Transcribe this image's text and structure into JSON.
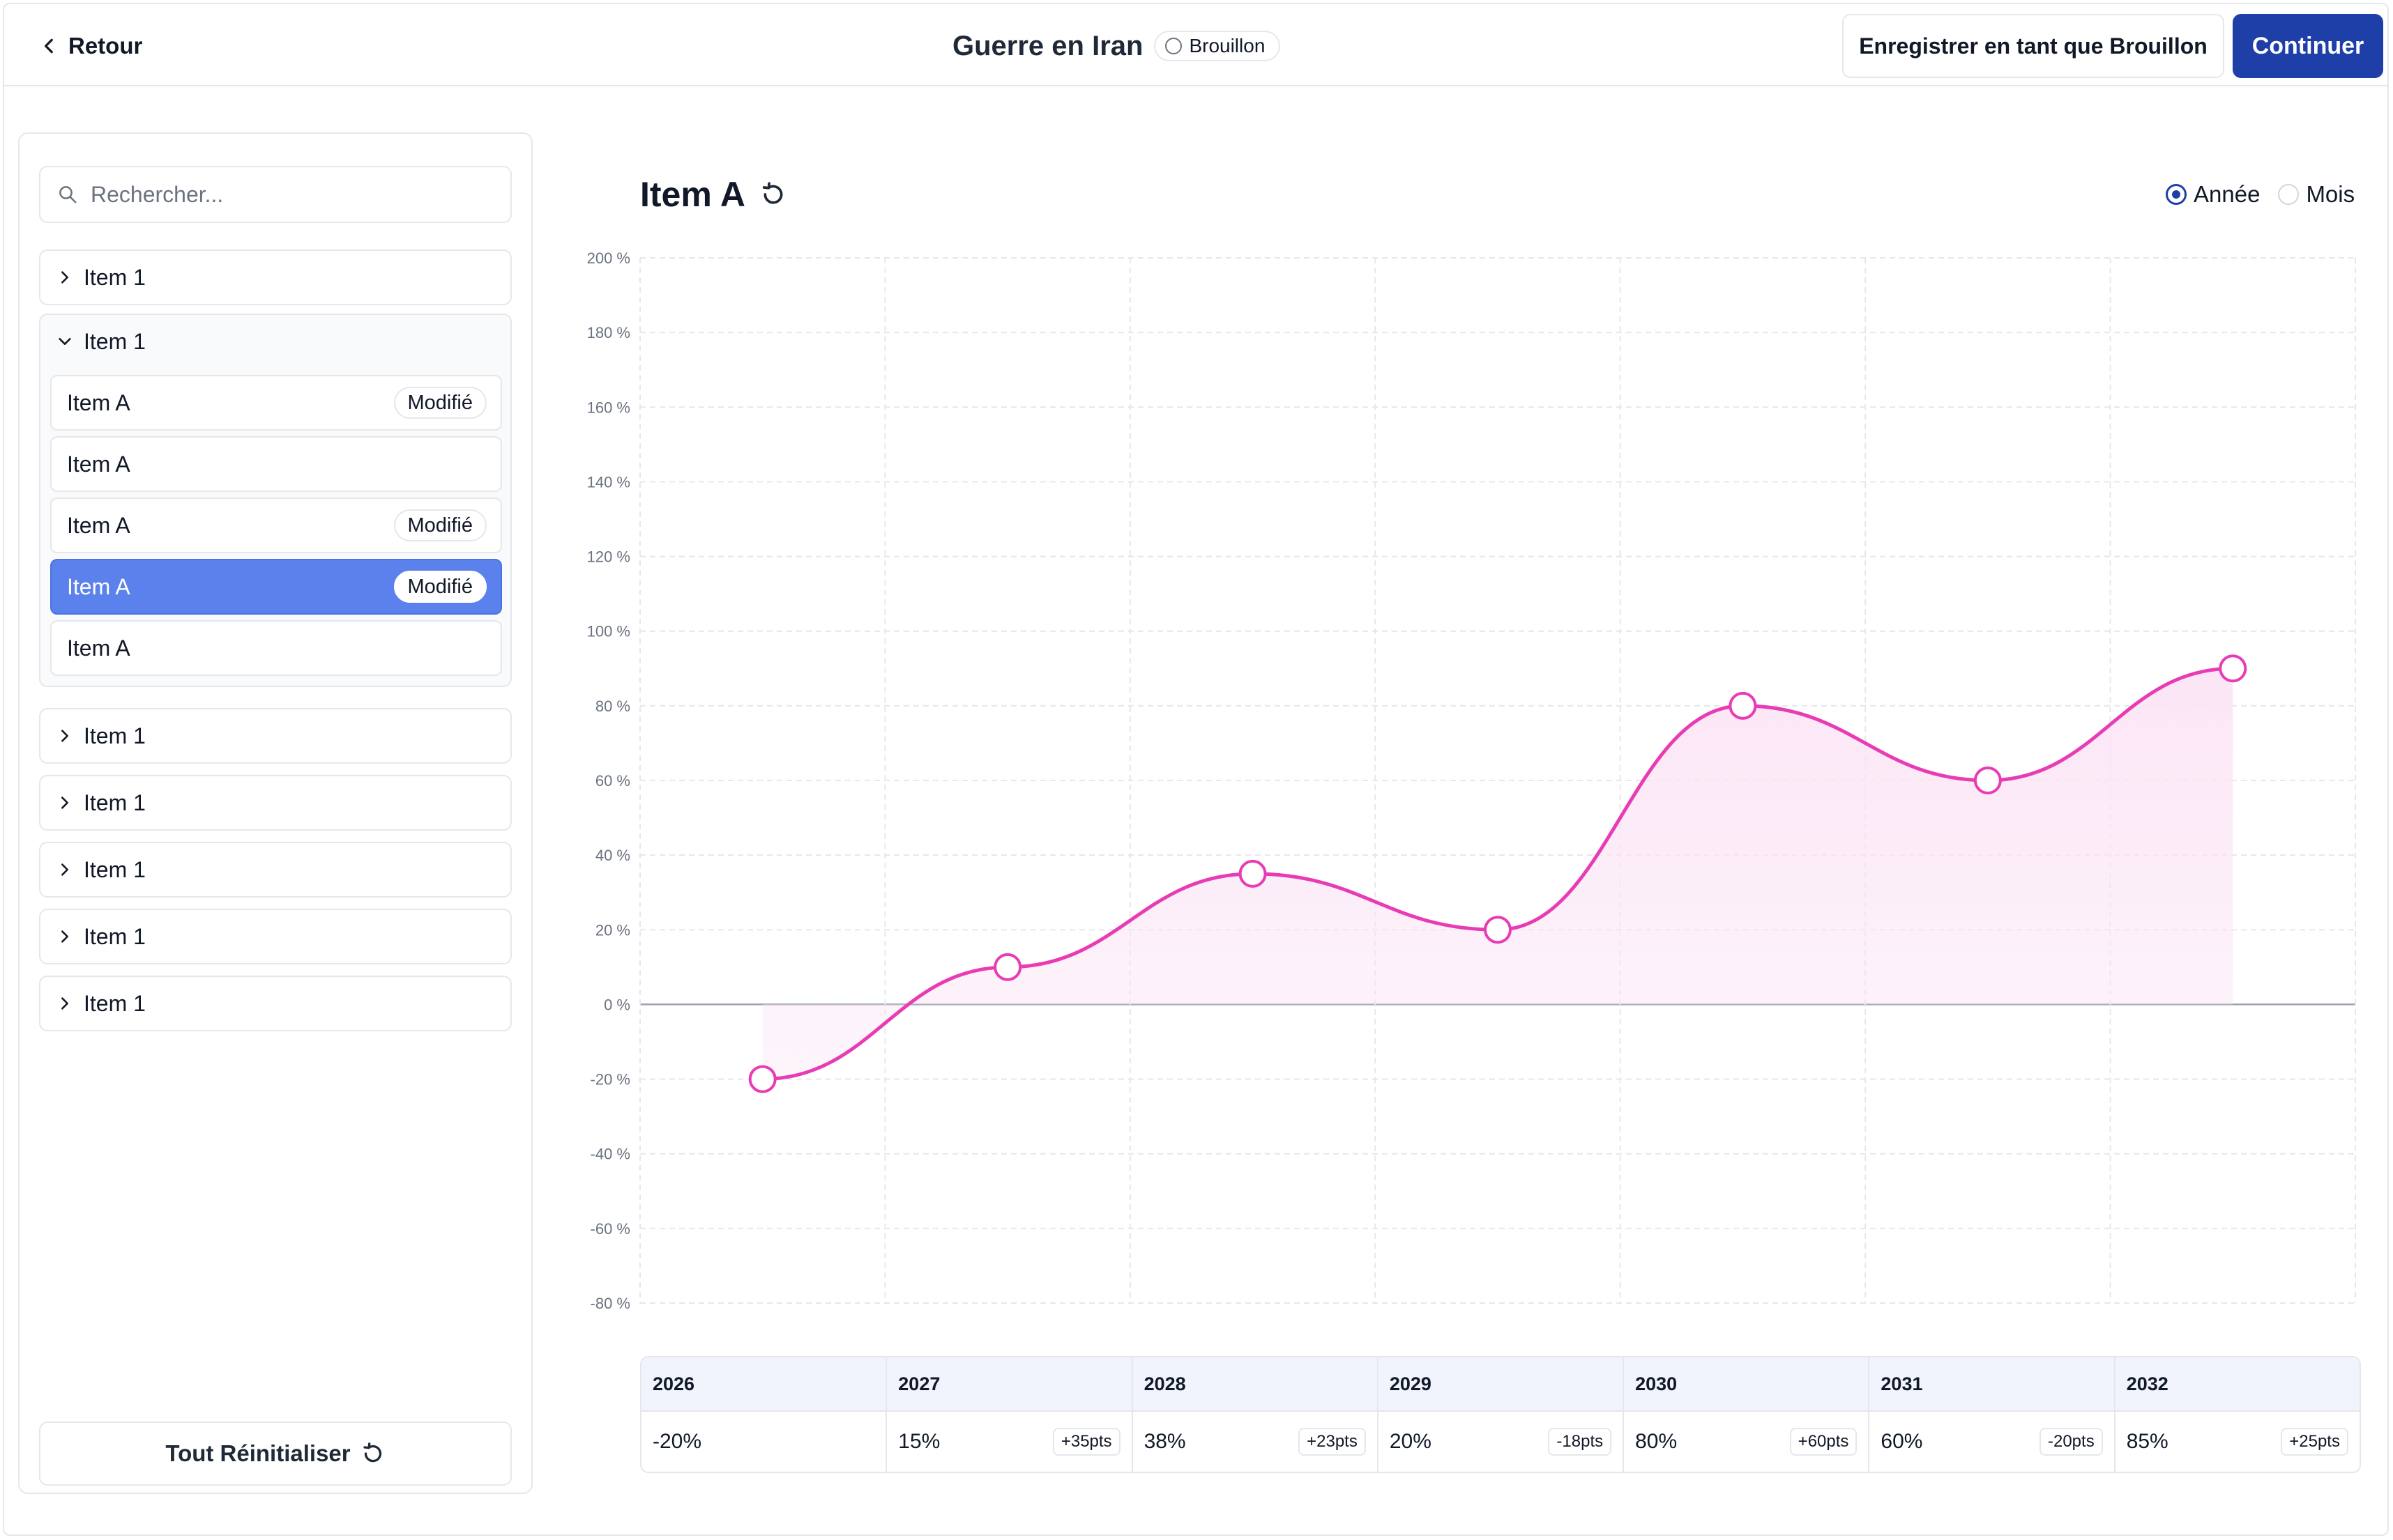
{
  "header": {
    "back_label": "Retour",
    "title": "Guerre en Iran",
    "status": "Brouillon",
    "save_draft_label": "Enregistrer en tant que Brouillon",
    "continue_label": "Continuer"
  },
  "sidebar": {
    "search_placeholder": "Rechercher...",
    "groups": [
      {
        "label": "Item 1",
        "expanded": false
      },
      {
        "label": "Item 1",
        "expanded": true,
        "items": [
          {
            "label": "Item A",
            "badge": "Modifié",
            "selected": false
          },
          {
            "label": "Item A",
            "badge": "",
            "selected": false
          },
          {
            "label": "Item A",
            "badge": "Modifié",
            "selected": false
          },
          {
            "label": "Item A",
            "badge": "Modifié",
            "selected": true
          },
          {
            "label": "Item A",
            "badge": "",
            "selected": false
          }
        ]
      },
      {
        "label": "Item 1",
        "expanded": false
      },
      {
        "label": "Item 1",
        "expanded": false
      },
      {
        "label": "Item 1",
        "expanded": false
      },
      {
        "label": "Item 1",
        "expanded": false
      },
      {
        "label": "Item 1",
        "expanded": false
      }
    ],
    "reset_all_label": "Tout Réinitialiser"
  },
  "main": {
    "title": "Item A",
    "period_options": [
      {
        "label": "Année",
        "checked": true
      },
      {
        "label": "Mois",
        "checked": false
      }
    ]
  },
  "chart_data": {
    "type": "area",
    "title": "",
    "xlabel": "",
    "ylabel": "",
    "x": [
      "2026",
      "2027",
      "2028",
      "2029",
      "2030",
      "2031",
      "2032"
    ],
    "series": [
      {
        "values": [
          -20,
          10,
          35,
          20,
          80,
          60,
          90
        ]
      }
    ],
    "ylim": [
      -80,
      200
    ],
    "yticks": [
      200,
      180,
      160,
      140,
      120,
      100,
      80,
      60,
      40,
      20,
      0,
      -20,
      -40,
      -60,
      -80
    ],
    "ytick_labels": [
      "200 %",
      "180 %",
      "160 %",
      "140 %",
      "120 %",
      "100 %",
      "80 %",
      "60 %",
      "40 %",
      "20 %",
      "0 %",
      "-20 %",
      "-40 %",
      "-60 %",
      "-80 %"
    ],
    "grid": true,
    "line_color": "#e83cb5",
    "fill_color": "#fbe4f5"
  },
  "table": {
    "columns": [
      {
        "year": "2026",
        "value": "-20%",
        "delta": ""
      },
      {
        "year": "2027",
        "value": "15%",
        "delta": "+35pts"
      },
      {
        "year": "2028",
        "value": "38%",
        "delta": "+23pts"
      },
      {
        "year": "2029",
        "value": "20%",
        "delta": "-18pts"
      },
      {
        "year": "2030",
        "value": "80%",
        "delta": "+60pts"
      },
      {
        "year": "2031",
        "value": "60%",
        "delta": "-20pts"
      },
      {
        "year": "2032",
        "value": "85%",
        "delta": "+25pts"
      }
    ]
  },
  "colors": {
    "primary": "#1e3fa8",
    "selected_item": "#5b82ec",
    "border": "#e5e7eb"
  }
}
